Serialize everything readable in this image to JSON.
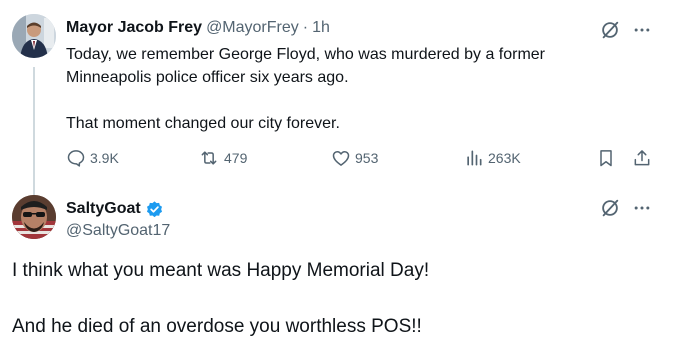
{
  "tweet": {
    "author_name": "Mayor Jacob Frey",
    "author_handle": "@MayorFrey",
    "separator": "·",
    "time": "1h",
    "line1": "Today, we remember George Floyd, who was murdered by a former",
    "line2": "Minneapolis police officer six years ago.",
    "line3": "That moment changed our city forever.",
    "replies": "3.9K",
    "reposts": "479",
    "likes": "953",
    "views": "263K"
  },
  "reply": {
    "author_name": "SaltyGoat",
    "author_handle": "@SaltyGoat17",
    "line1": "I think what you meant was Happy Memorial Day!",
    "line2": "And he died of an overdose you worthless POS!!"
  },
  "colors": {
    "verified": "#1d9bf0",
    "secondary_text": "#536471",
    "thread_line": "#cfd9de"
  }
}
